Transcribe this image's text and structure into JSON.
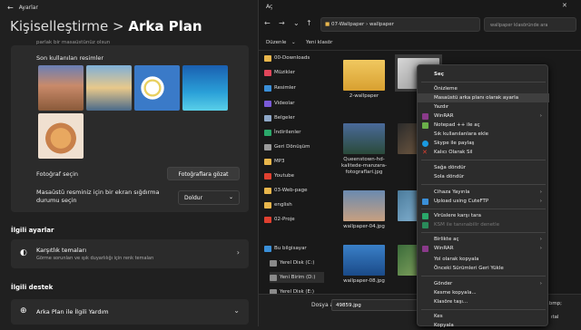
{
  "settings": {
    "app_name": "Ayarlar",
    "title_prefix": "Kişiselleştirme",
    "title_sep": ">",
    "title_page": "Arka Plan",
    "cut_text": "parlak bir masaüstünüz olsun",
    "recent_label": "Son kullanılan resimler",
    "choose_photo": "Fotoğraf seçin",
    "browse_btn": "Fotoğraflara gözat",
    "fit_label": "Masaüstü resminiz için bir ekran sığdırma durumu seçin",
    "fit_value": "Doldur",
    "related_title": "İlgili ayarlar",
    "contrast_title": "Karşıtlık temaları",
    "contrast_sub": "Görme sorunları ve ışık duyarlılığı için renk temaları",
    "support_title": "İlgili destek",
    "help_title": "Arka Plan ile İlgili Yardım"
  },
  "explorer": {
    "title": "Aç",
    "addr_folder": "07-Wallpaper",
    "addr_sub": "wallpaper",
    "search_placeholder": "wallpaper klasöründe ara",
    "cmd_organize": "Düzenle",
    "cmd_newfolder": "Yeni klasör",
    "tree": [
      "00-Downloads",
      "Müzikler",
      "Resimler",
      "Videolar",
      "Belgeler",
      "İndirilenler",
      "Geri Dönüşüm",
      "MP3",
      "Youtube",
      "03-Web-page",
      "english",
      "02-Proje",
      "Bu bilgisayar",
      "Yerel Disk (C:)",
      "Yeni Birim (D:)",
      "Yerel Disk (E:)"
    ],
    "files": [
      "2-wallpaper",
      "",
      "Queenstown-hd-kalitede-manzara-fotograflari.jpg",
      "",
      "wallpaper-04.jpg",
      "",
      "wallpaper-08.jpg"
    ],
    "filename_label": "Dosya adı:",
    "filename_value": "49859.jpg",
    "filetype_partial": ".bmp;",
    "open_partial": "ıtal"
  },
  "context_menu": [
    "Seç",
    "Önizleme",
    "Masaüstü arka planı olarak ayarla",
    "Yazdır",
    "WinRAR",
    "Notepad ++ ile aç",
    "Sık kullanılanlara ekle",
    "Skype ile paylaş",
    "Kalıcı Olarak Sil",
    "Sağa döndür",
    "Sola döndür",
    "Cihaza Yayınla",
    "Upload using CuteFTP",
    "Virüslere karşı tara",
    "KSM ile tanınabilir denetle",
    "Birlikte aç",
    "WinRAR",
    "Yol olarak kopyala",
    "Önceki Sürümleri Geri Yükle",
    "Gönder",
    "Kesme kopyala...",
    "Klasöre taşı...",
    "Kes",
    "Kopyala"
  ],
  "colors": {
    "accent": "#0078d4",
    "folder": "#e8b64c",
    "bg": "#202020"
  }
}
